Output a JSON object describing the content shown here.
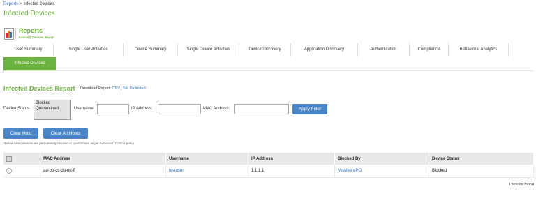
{
  "breadcrumb": {
    "parent": "Reports",
    "separator": ">",
    "current": "Infected Devices"
  },
  "page_title": "Infected Devices",
  "report_header": {
    "title": "Reports",
    "subtitle": "Infected Devices Report",
    "icon": "bar-chart-icon"
  },
  "tabs": [
    {
      "label": "User Summary"
    },
    {
      "label": "Single User Activities"
    },
    {
      "label": "Device Summary"
    },
    {
      "label": "Single Device Activities"
    },
    {
      "label": "Device Discovery"
    },
    {
      "label": "Application Discovery"
    },
    {
      "label": "Authentication"
    },
    {
      "label": "Compliance"
    },
    {
      "label": "Behavioral Analytics"
    },
    {
      "label": "Infected Devices",
      "active": true
    }
  ],
  "section": {
    "title": "Infected Devices Report",
    "download_label": "Download Report:",
    "csv": "CSV",
    "pipe": "|",
    "tab_delimited": "Tab Delimited"
  },
  "filters": {
    "device_status_label": "Device Status:",
    "status_options": [
      "Blocked",
      "Quarantined"
    ],
    "username_label": "Username:",
    "username_value": "",
    "ip_label": "IP Address:",
    "ip_value": "",
    "mac_label": "MAC Address:",
    "mac_value": "",
    "apply_button": "Apply Filter"
  },
  "actions": {
    "clear_host": "Clear Host",
    "clear_all_hosts": "Clear All Hosts"
  },
  "note": "*Below listed devices are permanently blocked or quarantined as per Admission Control policy",
  "table": {
    "columns": [
      "MAC Address",
      "Username",
      "IP Address",
      "Blocked By",
      "Device Status"
    ],
    "rows": [
      {
        "mac": "aa-bb-cc-dd-ee-ff",
        "username": "testuser",
        "ip": "1.1.1.1",
        "blocked_by": "McAfee ePO",
        "status": "Blocked"
      }
    ]
  },
  "results_count": "1 results found",
  "colors": {
    "accent_green": "#6db33f",
    "button_blue": "#4a86c7",
    "link_blue": "#2a6fbd"
  }
}
